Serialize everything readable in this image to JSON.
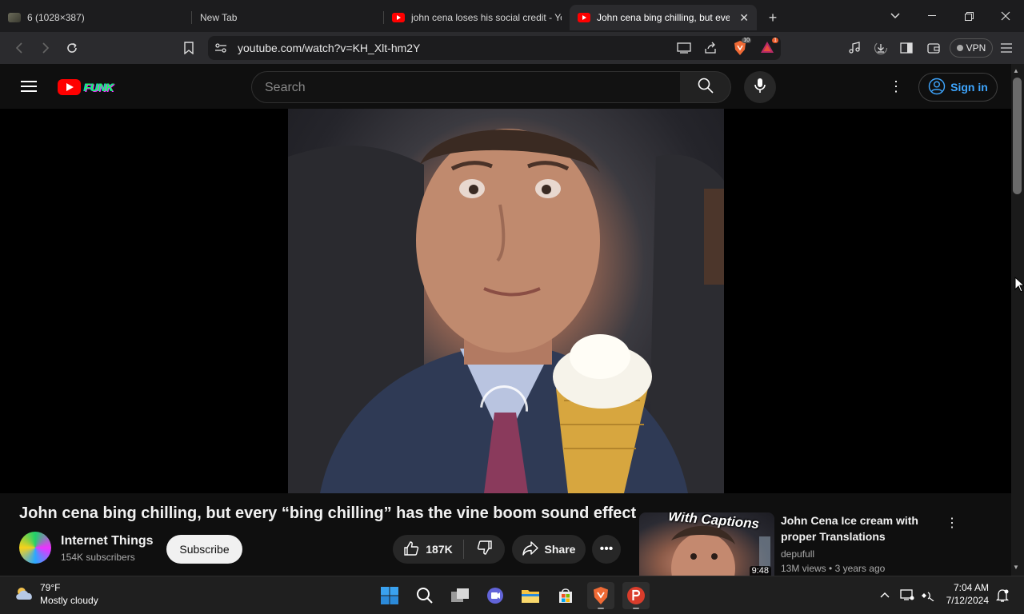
{
  "browser": {
    "tabs": [
      {
        "label": "6 (1028×387)",
        "favicon": "image-thumbnail-icon",
        "active": false
      },
      {
        "label": "New Tab",
        "favicon": "",
        "active": false
      },
      {
        "label": "john cena loses his social credit - You",
        "favicon": "youtube-icon",
        "active": false
      },
      {
        "label": "John cena bing chilling, but ever",
        "favicon": "youtube-icon",
        "active": true
      }
    ],
    "close_tab_glyph": "✕",
    "new_tab_glyph": "+",
    "url": "youtube.com/watch?v=KH_Xlt-hm2Y",
    "brave_shield_badge": "10",
    "rewards_badge": "1",
    "vpn_label": "VPN"
  },
  "youtube": {
    "logo_doodle_text": "FUNK",
    "search_placeholder": "Search",
    "signin_label": "Sign in",
    "video": {
      "title": "John cena bing chilling, but every “bing chilling” has the vine boom sound effect",
      "channel": "Internet Things",
      "subscribers": "154K subscribers",
      "subscribe_label": "Subscribe",
      "likes": "187K",
      "share_label": "Share"
    },
    "recommendation": {
      "thumb_overlay": "With Captions",
      "duration": "9:48",
      "title": "John Cena Ice cream with proper Translations",
      "channel": "depufull",
      "views": "13M views",
      "age": "3 years ago"
    }
  },
  "taskbar": {
    "weather_temp": "79°F",
    "weather_desc": "Mostly cloudy",
    "time": "7:04 AM",
    "date": "7/12/2024"
  },
  "colors": {
    "youtube_red": "#ff0000",
    "link_blue": "#3ea6ff",
    "page_bg": "#0f0f0f",
    "pill_bg": "#272727"
  }
}
